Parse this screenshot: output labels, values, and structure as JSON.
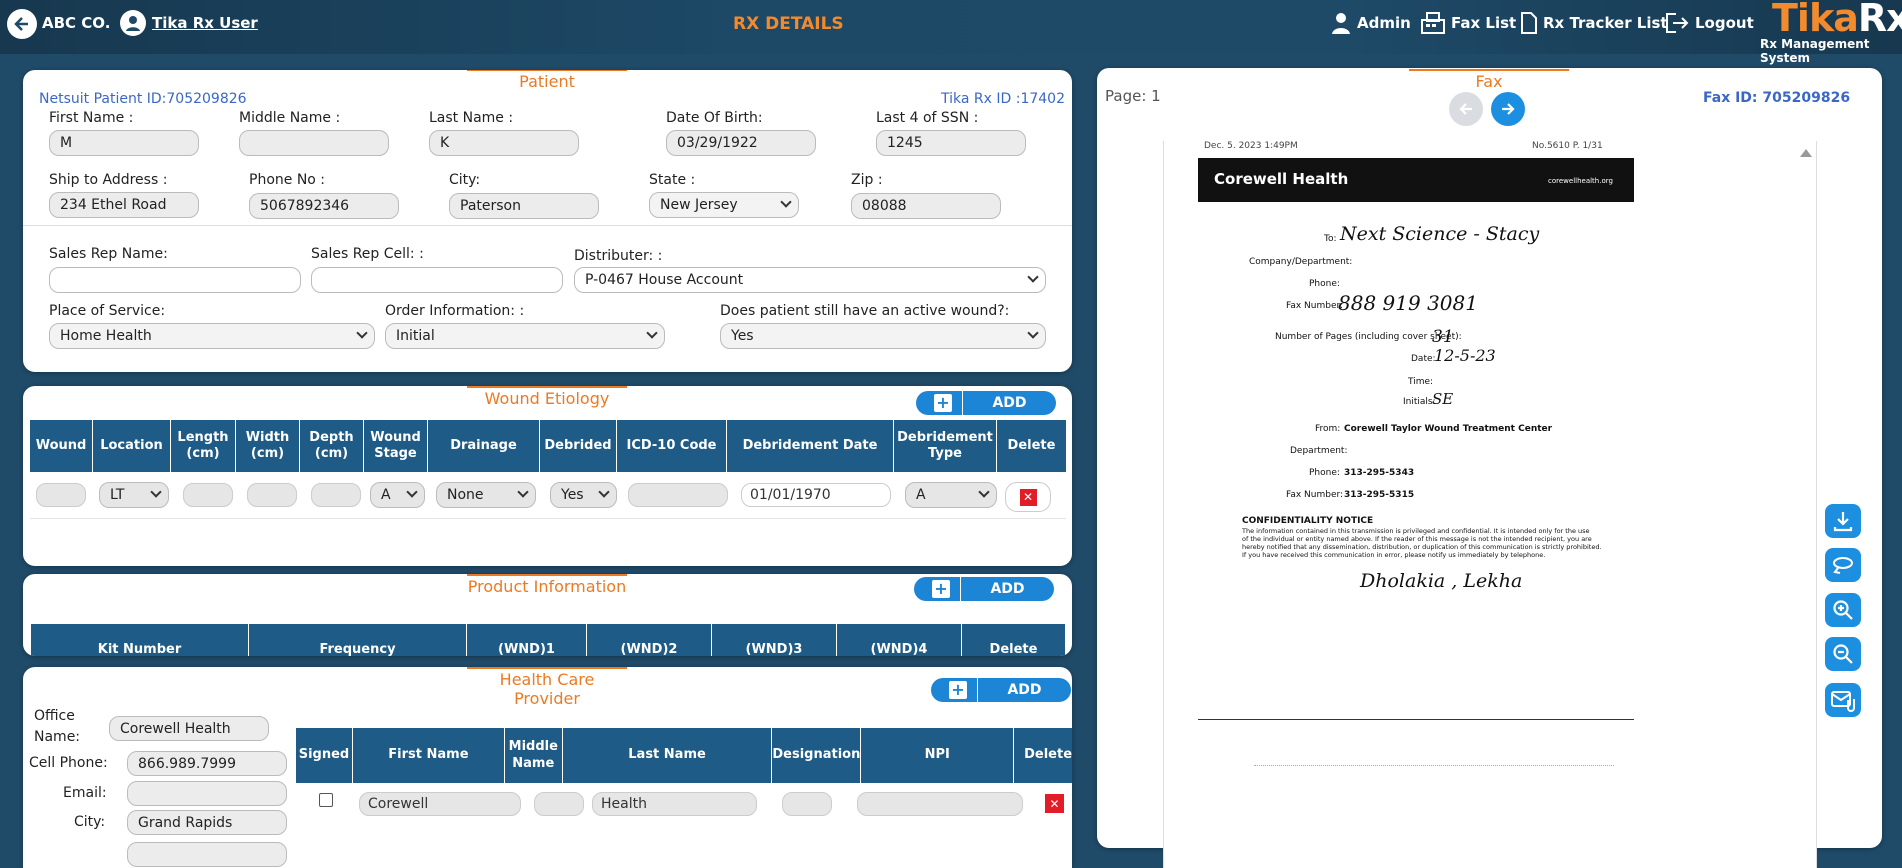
{
  "header": {
    "company": "ABC CO.",
    "user": "Tika Rx User",
    "title": "RX DETAILS",
    "nav": [
      "Admin",
      "Fax List",
      "Rx Tracker List",
      "Logout"
    ],
    "logo_a": "Tika",
    "logo_b": "Rx",
    "logo_sub": "Rx Management System"
  },
  "patient": {
    "section": "Patient",
    "netsuite": "Netsuit Patient ID:705209826",
    "tika_id": "Tika Rx ID :17402",
    "labels": {
      "first": "First Name :",
      "middle": "Middle Name :",
      "last": "Last Name :",
      "dob": "Date Of Birth:",
      "ssn": "Last 4 of SSN :",
      "address": "Ship to Address :",
      "phone": "Phone No :",
      "city": "City:",
      "state": "State :",
      "zip": "Zip :",
      "sales_rep": "Sales Rep Name:",
      "sales_cell": "Sales Rep Cell: :",
      "distributer": "Distributer: :",
      "pos": "Place of Service:",
      "order": "Order Information: :",
      "wound_q": "Does patient still have an active wound?:"
    },
    "values": {
      "first": "M",
      "middle": "",
      "last": "K",
      "dob": "03/29/1922",
      "ssn": "1245",
      "address": "234 Ethel Road",
      "phone": "5067892346",
      "city": "Paterson",
      "state": "New Jersey",
      "zip": "08088",
      "sales_rep": "",
      "sales_cell": "",
      "distributer": "P-0467 House Account",
      "pos": "Home Health",
      "order": "Initial",
      "wound_q": "Yes"
    }
  },
  "wound": {
    "section": "Wound Etiology",
    "add": "ADD",
    "columns": [
      "Wound",
      "Location",
      "Length (cm)",
      "Width (cm)",
      "Depth (cm)",
      "Wound Stage",
      "Drainage",
      "Debrided",
      "ICD-10 Code",
      "Debridement Date",
      "Debridement Type",
      "Delete"
    ],
    "row": {
      "location": "LT",
      "stage": "A",
      "drainage": "None",
      "debrided": "Yes",
      "date": "01/01/1970",
      "type": "A"
    }
  },
  "product": {
    "section": "Product Information",
    "add": "ADD",
    "columns": [
      "Kit Number",
      "Frequency",
      "(WND)1",
      "(WND)2",
      "(WND)3",
      "(WND)4",
      "Delete"
    ]
  },
  "provider": {
    "section": "Health Care Provider",
    "add": "ADD",
    "labels": {
      "office": "Office Name:",
      "cell": "Cell Phone:",
      "email": "Email:",
      "city": "City:"
    },
    "values": {
      "office": "Corewell Health",
      "cell": "866.989.7999",
      "email": "",
      "city": "Grand Rapids"
    },
    "columns": [
      "Signed",
      "First Name",
      "Middle Name",
      "Last Name",
      "Designation",
      "NPI",
      "Delete"
    ],
    "row": {
      "first": "Corewell",
      "middle": "",
      "last": "Health",
      "designation": "",
      "npi": ""
    }
  },
  "fax": {
    "section": "Fax",
    "page": "Page: 1",
    "fax_id": "Fax ID: 705209826",
    "doc": {
      "header_left": "Dec. 5. 2023  1:49PM",
      "header_right": "No.5610   P. 1/31",
      "brand": "Corewell Health",
      "brand_url": "corewellhealth.org",
      "to_label": "To:",
      "to": "Next Science - Stacy",
      "company_label": "Company/Department:",
      "phone_label": "Phone:",
      "faxnum_label": "Fax Number:",
      "faxnum": "888  919  3081",
      "pages_label": "Number of Pages (including cover sheet):",
      "pages": "31",
      "date_label": "Date:",
      "date": "12-5-23",
      "time_label": "Time:",
      "initials_label": "Initials:",
      "initials": "SE",
      "from_label": "From:",
      "from": "Corewell Taylor Wound Treatment Center",
      "dept_label": "Department:",
      "dphone_label": "Phone:",
      "dphone": "313-295-5343",
      "dfax_label": "Fax Number:",
      "dfax": "313-295-5315",
      "notice_title": "CONFIDENTIALITY NOTICE",
      "notice": [
        "The information contained in this transmission is privileged and confidential.  It is intended only for the use",
        "of the individual or entity named above.  If the reader of this message is not the intended recipient, you are",
        "hereby notified that any dissemination, distribution, or duplication of this communication is strictly prohibited.",
        "If you have received this communication in error, please notify us immediately by telephone."
      ],
      "signature": "Dholakia , Lekha"
    }
  }
}
